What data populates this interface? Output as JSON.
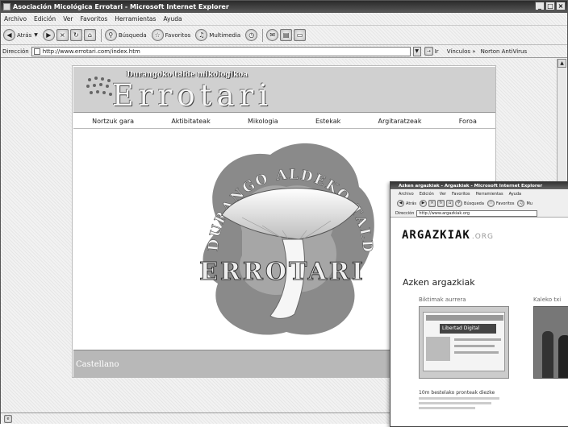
{
  "window": {
    "title": "Asociación Micológica Errotari - Microsoft Internet Explorer",
    "buttons": [
      "_",
      "□",
      "×"
    ]
  },
  "menu": [
    "Archivo",
    "Edición",
    "Ver",
    "Favoritos",
    "Herramientas",
    "Ayuda"
  ],
  "toolbar": {
    "back": "Atrás",
    "search": "Búsqueda",
    "favorites": "Favoritos",
    "multimedia": "Multimedia"
  },
  "address_bar": {
    "label": "Dirección",
    "url": "http://www.errotari.com/index.htm",
    "go": "Ir",
    "links": "Vínculos",
    "chevron": "»",
    "antivirus": "Norton AntiVirus"
  },
  "site": {
    "tagline": "Durangoko talde mikologikoa",
    "brand": "Errotari",
    "nav": [
      "Nortzuk gara",
      "Aktibitateak",
      "Mikologia",
      "Estekak",
      "Argitaratzeak",
      "Foroa"
    ],
    "logo_ring_text": "DURANGO ALDEKO TALDE MIKOLOGIKOA",
    "logo_text": "ERROTARI",
    "footer_link": "Castellano"
  },
  "window2": {
    "title": "Azken argazkiak - Argazkiak - Microsoft Internet Explorer",
    "menu": [
      "Archivo",
      "Edición",
      "Ver",
      "Favoritos",
      "Herramientas",
      "Ayuda"
    ],
    "toolbar": {
      "back": "Atrás",
      "search": "Búsqueda",
      "favorites": "Favoritos",
      "multimedia": "Mu"
    },
    "address_label": "Dirección",
    "url": "http://www.argazkiak.org",
    "logo": "ARGAZKIAK",
    "logo_suffix": ".ORG",
    "heading": "Azken argazkiak",
    "col1_title": "Biktimak aurrera",
    "col2_title": "Kaleko txi",
    "thumb_site": "Libertad Digital",
    "caption": "10m bestelako pronteak diezke"
  },
  "colors": {
    "page_bg": "#f2f2f2",
    "header_bg": "#d0d0d0",
    "footer_bg": "#b8b8b8",
    "titlebar": "#3a3a3a"
  }
}
